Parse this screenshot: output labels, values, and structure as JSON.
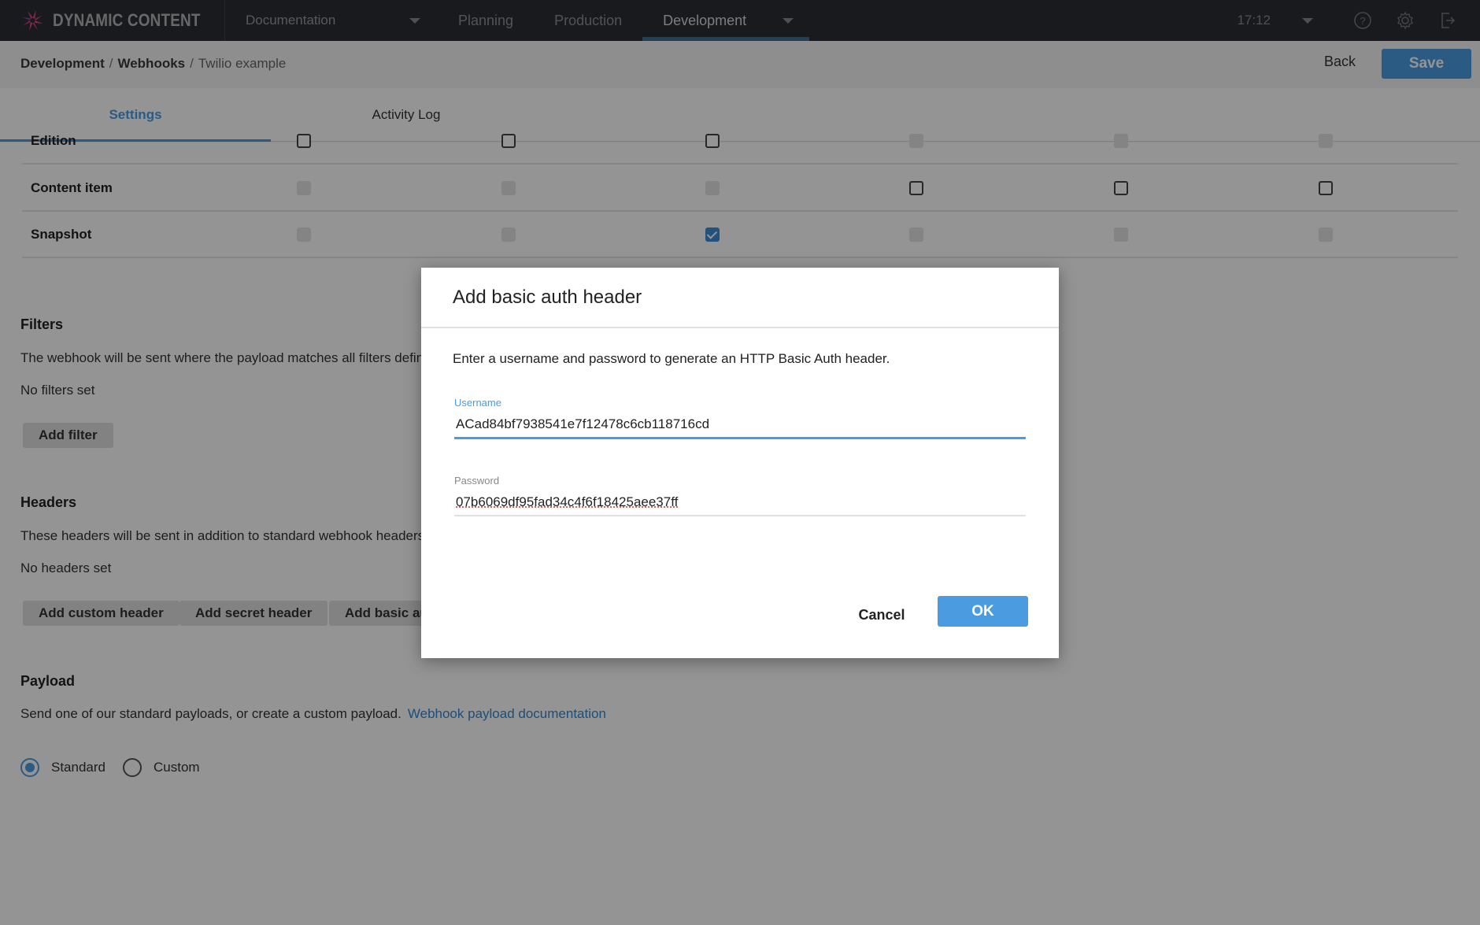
{
  "app": {
    "brand": "DYNAMIC CONTENT",
    "hub": "Documentation",
    "nav_tabs": [
      {
        "label": "Planning",
        "active": false
      },
      {
        "label": "Production",
        "active": false
      },
      {
        "label": "Development",
        "active": true
      }
    ],
    "time": "17:12",
    "icons": [
      "help-icon",
      "settings-gear-icon",
      "logout-icon"
    ]
  },
  "subheader": {
    "breadcrumb": [
      "Development",
      "Webhooks",
      "Twilio example"
    ],
    "back_label": "Back",
    "save_label": "Save"
  },
  "tabs": [
    {
      "label": "Settings",
      "active": true
    },
    {
      "label": "Activity Log",
      "active": false
    }
  ],
  "triggers": {
    "rows": [
      {
        "label": "Edition",
        "checkboxes": [
          "enabled",
          "enabled",
          "enabled",
          "disabled",
          "disabled",
          "disabled"
        ]
      },
      {
        "label": "Content item",
        "checkboxes": [
          "disabled",
          "disabled",
          "disabled",
          "enabled",
          "enabled",
          "enabled"
        ]
      },
      {
        "label": "Snapshot",
        "checkboxes": [
          "disabled",
          "disabled",
          "checked",
          "disabled",
          "disabled",
          "disabled"
        ]
      }
    ]
  },
  "filters": {
    "title": "Filters",
    "description": "The webhook will be sent where the payload matches all filters defin",
    "empty": "No filters set",
    "add_label": "Add filter"
  },
  "headers": {
    "title": "Headers",
    "description": "These headers will be sent in addition to standard webhook headers",
    "empty": "No headers set",
    "buttons": [
      "Add custom header",
      "Add secret header",
      "Add basic auth header"
    ]
  },
  "payload": {
    "title": "Payload",
    "description": "Send one of our standard payloads, or create a custom payload.",
    "link": "Webhook payload documentation",
    "options": [
      {
        "label": "Standard",
        "selected": true
      },
      {
        "label": "Custom",
        "selected": false
      }
    ]
  },
  "dialog": {
    "title": "Add basic auth header",
    "description": "Enter a username and password to generate an HTTP Basic Auth header.",
    "username_label": "Username",
    "username_value": "ACad84bf7938541e7f12478c6cb118716cd",
    "password_label": "Password",
    "password_value": "07b6069df95fad34c4f6f18425aee37ff",
    "cancel_label": "Cancel",
    "ok_label": "OK"
  },
  "colors": {
    "accent": "#4a9be0",
    "nav_bg": "#2a2e35"
  }
}
